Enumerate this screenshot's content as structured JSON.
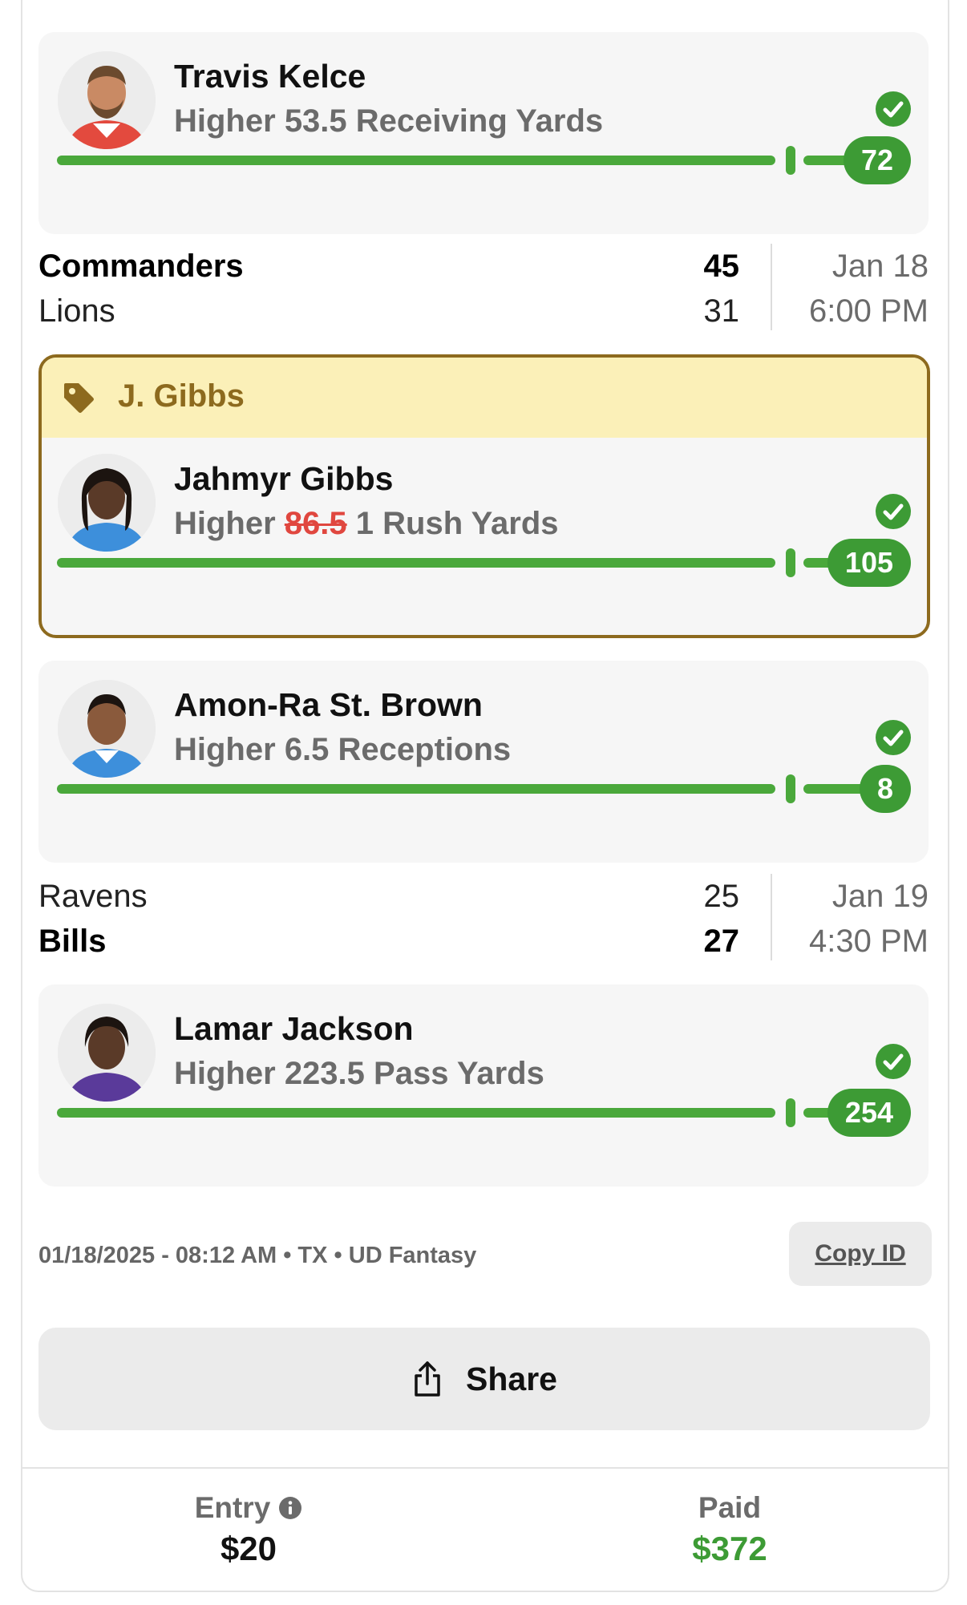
{
  "cards": [
    {
      "player": "Travis Kelce",
      "pick_direction": "Higher",
      "line": "53.5",
      "stat": "Receiving Yards",
      "result": "72",
      "progress": 1.0,
      "jersey_color": "#e34a3e"
    },
    {
      "player": "Jahmyr Gibbs",
      "pick_direction": "Higher",
      "line_original": "86.5",
      "line": "1",
      "stat": "Rush Yards",
      "result": "105",
      "progress": 1.0,
      "jersey_color": "#3d8fdb"
    },
    {
      "player": "Amon-Ra St. Brown",
      "pick_direction": "Higher",
      "line": "6.5",
      "stat": "Receptions",
      "result": "8",
      "progress": 1.0,
      "jersey_color": "#3d8fdb"
    },
    {
      "player": "Lamar Jackson",
      "pick_direction": "Higher",
      "line": "223.5",
      "stat": "Pass Yards",
      "result": "254",
      "progress": 1.0,
      "jersey_color": "#5a3a9a"
    }
  ],
  "games": [
    {
      "team1": "Commanders",
      "score1": "45",
      "team2": "Lions",
      "score2": "31",
      "date": "Jan 18",
      "time": "6:00 PM"
    },
    {
      "team1": "Ravens",
      "score1": "25",
      "team2": "Bills",
      "score2": "27",
      "date": "Jan 19",
      "time": "4:30 PM"
    }
  ],
  "promo": {
    "label": "J. Gibbs"
  },
  "meta": {
    "timestamp_line": "01/18/2025 - 08:12 AM • TX • UD Fantasy",
    "copy_id_label": "Copy ID"
  },
  "share": {
    "label": "Share"
  },
  "footer": {
    "entry_label": "Entry",
    "entry_value": "$20",
    "paid_label": "Paid",
    "paid_value": "$372"
  },
  "colors": {
    "success_green": "#3d9b35",
    "strike_red": "#e0473f",
    "promo_border": "#8d6a1e",
    "promo_bg": "#fbf0b8"
  }
}
